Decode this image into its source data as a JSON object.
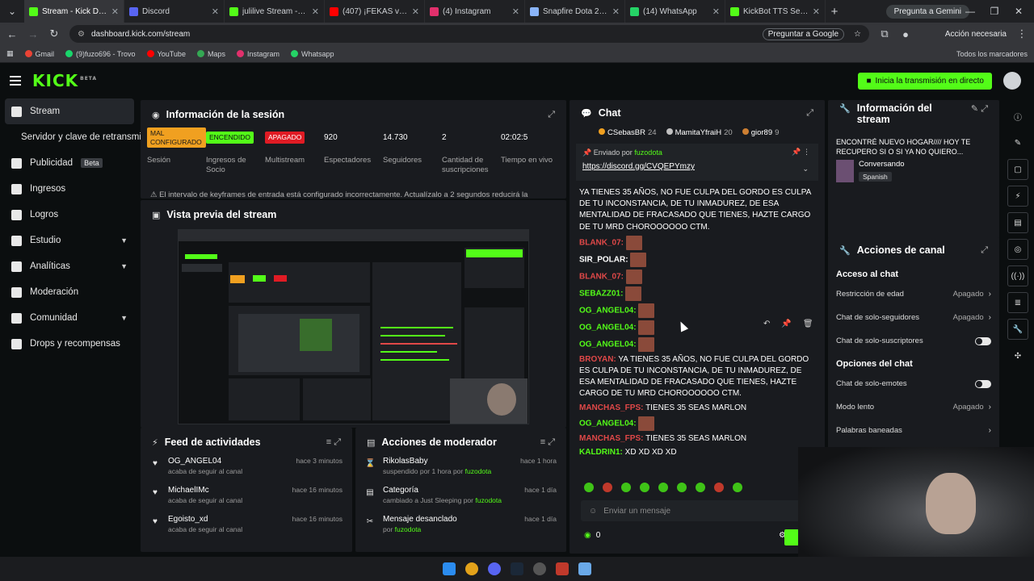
{
  "browser": {
    "tabs": [
      {
        "title": "Stream - Kick Dashbo",
        "color": "#53fc18",
        "active": true
      },
      {
        "title": "Discord",
        "color": "#5865f2"
      },
      {
        "title": "julilive Stream - Wat",
        "color": "#53fc18"
      },
      {
        "title": "(407) ¡FEKAS vs AI",
        "color": "#ff0000"
      },
      {
        "title": "(4) Instagram",
        "color": "#e1306c"
      },
      {
        "title": "Snapfire Dota 2 Tabu",
        "color": "#8ab4f8"
      },
      {
        "title": "(14) WhatsApp",
        "color": "#25d366"
      },
      {
        "title": "KickBot TTS Settings",
        "color": "#53fc18"
      }
    ],
    "gemini_label": "Pregunta a Gemini",
    "url": "dashboard.kick.com/stream",
    "translate_label": "Preguntar a Google",
    "action_label": "Acción necesaria",
    "bookmarks": [
      {
        "label": "Gmail",
        "color": "#ea4335"
      },
      {
        "label": "(9)fuzo696 - Trovo",
        "color": "#19d66b"
      },
      {
        "label": "YouTube",
        "color": "#ff0000"
      },
      {
        "label": "Maps",
        "color": "#34a853"
      },
      {
        "label": "Instagram",
        "color": "#e1306c"
      },
      {
        "label": "Whatsapp",
        "color": "#25d366"
      }
    ],
    "all_bookmarks": "Todos los marcadores"
  },
  "header": {
    "logo": "KICK",
    "logo_sup": "BETA",
    "go_live": "Inicia la transmisión en directo"
  },
  "sidebar": [
    {
      "label": "Stream",
      "active": true
    },
    {
      "label": "Servidor y clave de retransmisión",
      "indent": true
    },
    {
      "label": "Publicidad",
      "badge": "Beta"
    },
    {
      "label": "Ingresos"
    },
    {
      "label": "Logros"
    },
    {
      "label": "Estudio",
      "chev": true
    },
    {
      "label": "Analíticas",
      "chev": true
    },
    {
      "label": "Moderación"
    },
    {
      "label": "Comunidad",
      "chev": true
    },
    {
      "label": "Drops y recompensas"
    }
  ],
  "session": {
    "title": "Información de la sesión",
    "stats": [
      {
        "value": "MAL CONFIGURADO",
        "label": "Sesión",
        "badge": "#f0a020",
        "text": "#1a1a1a"
      },
      {
        "value": "ENCENDIDO",
        "label": "Ingresos de Socio",
        "badge": "#53fc18",
        "text": "#0b0e0f"
      },
      {
        "value": "APAGADO",
        "label": "Multistream",
        "badge": "#e01b24",
        "text": "#ffffff"
      },
      {
        "value": "920",
        "label": "Espectadores"
      },
      {
        "value": "14.730",
        "label": "Seguidores"
      },
      {
        "value": "2",
        "label": "Cantidad de suscripciones"
      },
      {
        "value": "02:02:5",
        "label": "Tiempo en vivo"
      }
    ],
    "warning": "El intervalo de keyframes de entrada está configurado incorrectamente. Actualízalo a 2 segundos reducirá la"
  },
  "preview": {
    "title": "Vista previa del stream"
  },
  "feed": {
    "title": "Feed de actividades",
    "items": [
      {
        "name": "OG_ANGEL04",
        "sub": "acaba de seguir al canal",
        "time": "hace 3 minutos"
      },
      {
        "name": "MichaelIMc",
        "sub": "acaba de seguir al canal",
        "time": "hace 16 minutos"
      },
      {
        "name": "Egoisto_xd",
        "sub": "acaba de seguir al canal",
        "time": "hace 16 minutos"
      }
    ]
  },
  "moderator": {
    "title": "Acciones de moderador",
    "items": [
      {
        "name": "RikolasBaby",
        "sub": "suspendido por 1 hora por",
        "by": "fuzodota",
        "time": "hace 1 hora",
        "icon": "⌛"
      },
      {
        "name": "Categoría",
        "sub": "cambiado a Just Sleeping por",
        "by": "fuzodota",
        "time": "hace 1 día",
        "icon": "▤"
      },
      {
        "name": "Mensaje desanclado",
        "sub": "por",
        "by": "fuzodota",
        "time": "hace 1 día",
        "icon": "✂"
      }
    ]
  },
  "chat": {
    "title": "Chat",
    "gifters": [
      {
        "name": "CSebasBR",
        "count": "24",
        "color": "#f0a020"
      },
      {
        "name": "MamitaYfraiH",
        "count": "20",
        "color": "#c0c0c0"
      },
      {
        "name": "gior89",
        "count": "9",
        "color": "#cd7f32"
      }
    ],
    "pinned_by": "Enviado por",
    "pinned_user": "fuzodota",
    "pinned_link": "https://discord.gg/CVQEPYmzy",
    "messages": [
      {
        "user": "",
        "color": "#e04848",
        "text": "YA TIENES 35 AÑOS, NO FUE CULPA DEL GORDO ES CULPA DE TU INCONSTANCIA, DE TU INMADUREZ, DE ESA MENTALIDAD DE FRACASADO QUE TIENES, HAZTE CARGO DE TU MRD CHOROOOOOO CTM."
      },
      {
        "user": "Blank_07:",
        "color": "#e04848",
        "text": "",
        "emote": true
      },
      {
        "user": "Sir_Polar:",
        "color": "#ffffff",
        "text": "",
        "emote": true
      },
      {
        "user": "Blank_07:",
        "color": "#e04848",
        "text": "",
        "emote": true
      },
      {
        "user": "sebazz01:",
        "color": "#53fc18",
        "text": "",
        "emote": true
      },
      {
        "user": "OG_ANGEL04:",
        "color": "#53fc18",
        "text": "",
        "emote": true
      },
      {
        "user": "OG_ANGEL04:",
        "color": "#53fc18",
        "text": "",
        "emote": true
      },
      {
        "user": "OG_ANGEL04:",
        "color": "#53fc18",
        "text": "",
        "emote": true
      },
      {
        "user": "Broyan:",
        "color": "#e04848",
        "text": "YA TIENES 35 AÑOS, NO FUE CULPA DEL GORDO ES CULPA DE TU INCONSTANCIA, DE TU INMADUREZ, DE ESA MENTALIDAD DE FRACASADO QUE TIENES, HAZTE CARGO DE TU MRD CHOROOOOOO CTM."
      },
      {
        "user": "Manchas_fps:",
        "color": "#e04848",
        "text": "TIENES 35 SEAS MARLON"
      },
      {
        "user": "OG_ANGEL04:",
        "color": "#53fc18",
        "text": "",
        "emote": true
      },
      {
        "user": "Manchas_fps:",
        "color": "#e04848",
        "text": "TIENES 35 SEAS MARLON"
      },
      {
        "user": "kaldrin1:",
        "color": "#53fc18",
        "text": "xd xd xd xd"
      }
    ],
    "input_placeholder": "Enviar un mensaje",
    "points": "0"
  },
  "info": {
    "title": "Información del stream",
    "stream_title": "ENCONTRÉ NUEVO HOGAR//// HOY TE RECUPERO SI O SI YA NO QUIERO...",
    "category": "Conversando",
    "language": "Spanish"
  },
  "actions": {
    "title": "Acciones de canal",
    "section1": "Acceso al chat",
    "rows1": [
      {
        "label": "Restricción de edad",
        "value": "Apagado"
      },
      {
        "label": "Chat de solo-seguidores",
        "value": "Apagado"
      },
      {
        "label": "Chat de solo-suscriptores",
        "toggle": true
      }
    ],
    "section2": "Opciones del chat",
    "rows2": [
      {
        "label": "Chat de solo-emotes",
        "toggle": true
      },
      {
        "label": "Modo lento",
        "value": "Apagado"
      },
      {
        "label": "Palabras baneadas",
        "value": ""
      }
    ]
  }
}
